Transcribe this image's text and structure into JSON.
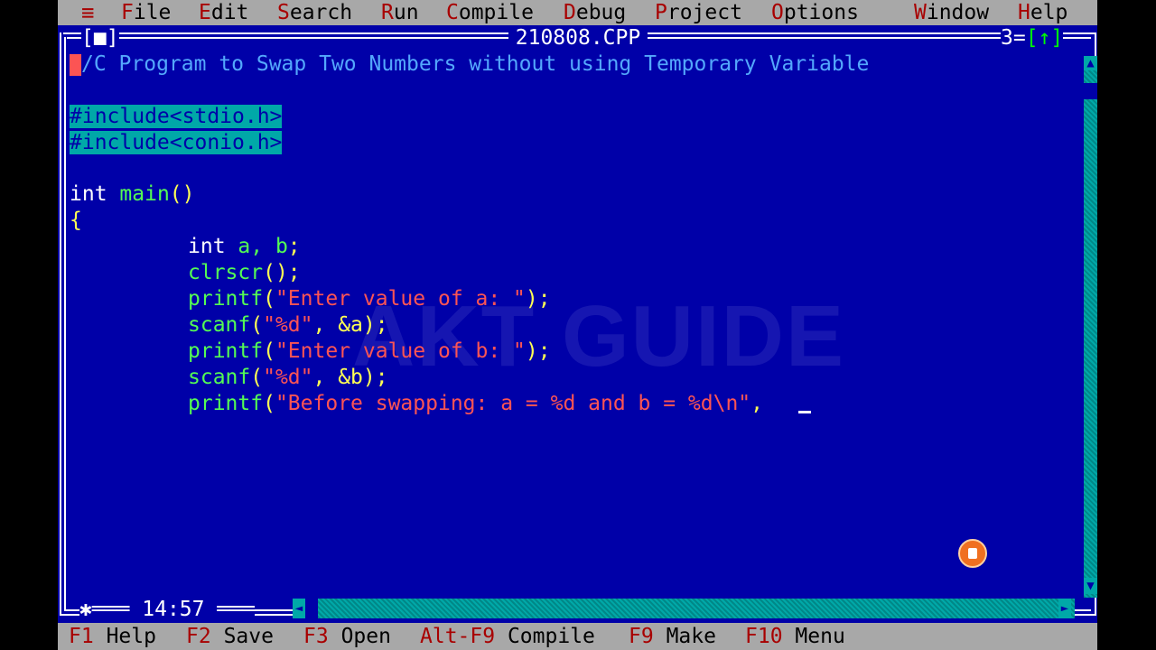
{
  "menubar": {
    "system_icon": "≡",
    "items": [
      {
        "hot": "F",
        "rest": "ile"
      },
      {
        "hot": "E",
        "rest": "dit"
      },
      {
        "hot": "S",
        "rest": "earch"
      },
      {
        "hot": "R",
        "rest": "un"
      },
      {
        "hot": "C",
        "rest": "ompile"
      },
      {
        "hot": "D",
        "rest": "ebug"
      },
      {
        "hot": "P",
        "rest": "roject"
      },
      {
        "hot": "O",
        "rest": "ptions"
      },
      {
        "hot": "W",
        "rest": "indow"
      },
      {
        "hot": "H",
        "rest": "elp"
      }
    ]
  },
  "window": {
    "title": "210808.CPP",
    "close_box": "[■]",
    "number": "3",
    "zoom_box": "[↑]",
    "cursor_position": "14:57"
  },
  "code": {
    "line1_comment": "/C Program to Swap Two Numbers without using Temporary Variable",
    "line1_marker": "/",
    "include1": "#include<stdio.h>",
    "include2": "#include<conio.h>",
    "main_kw": "int",
    "main_name": "main",
    "main_parens": "()",
    "open_brace": "{",
    "decl_kw": "int",
    "decl_vars": "a, b",
    "semicolon": ";",
    "clrscr": "clrscr",
    "clrscr_call": "();",
    "printf1_name": "printf",
    "printf1_open": "(",
    "printf1_str": "\"Enter value of a: \"",
    "printf1_close": ");",
    "scanf1_name": "scanf",
    "scanf1_open": "(",
    "scanf1_str": "\"%d\"",
    "scanf1_rest": ", &a);",
    "printf2_name": "printf",
    "printf2_open": "(",
    "printf2_str": "\"Enter value of b: \"",
    "printf2_close": ");",
    "scanf2_name": "scanf",
    "scanf2_open": "(",
    "scanf2_str": "\"%d\"",
    "scanf2_rest": ", &b);",
    "printf3_name": "printf",
    "printf3_open": "(",
    "printf3_str": "\"Before swapping: a = %d and b = %d\\n\"",
    "printf3_rest": ", "
  },
  "watermark": "AKT GUIDE",
  "fkeys": [
    {
      "key": "F1",
      "label": "Help"
    },
    {
      "key": "F2",
      "label": "Save"
    },
    {
      "key": "F3",
      "label": "Open"
    },
    {
      "key": "Alt-F9",
      "label": "Compile"
    },
    {
      "key": "F9",
      "label": "Make"
    },
    {
      "key": "F10",
      "label": "Menu"
    }
  ],
  "colors": {
    "editor_bg": "#0000a8",
    "menu_bg": "#a8a8a8",
    "hotkey": "#a80000",
    "string": "#fc5454",
    "function": "#54fc54",
    "identifier": "#ffff54",
    "comment": "#54a8fc"
  }
}
